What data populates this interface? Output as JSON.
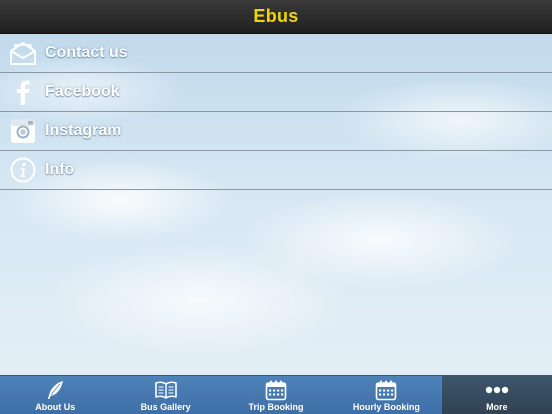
{
  "header": {
    "title": "Ebus"
  },
  "menu": {
    "items": [
      {
        "label": "Contact us",
        "icon": "envelope-icon"
      },
      {
        "label": "Facebook",
        "icon": "facebook-icon"
      },
      {
        "label": "Instagram",
        "icon": "instagram-icon"
      },
      {
        "label": "Info",
        "icon": "info-icon"
      }
    ]
  },
  "tabbar": {
    "tabs": [
      {
        "label": "About Us",
        "icon": "quill-icon",
        "active": false
      },
      {
        "label": "Bus Gallery",
        "icon": "book-icon",
        "active": false
      },
      {
        "label": "Trip Booking",
        "icon": "calendar-icon",
        "active": false
      },
      {
        "label": "Hourly Booking",
        "icon": "calendar-icon",
        "active": false
      },
      {
        "label": "More",
        "icon": "more-dots-icon",
        "active": true
      }
    ]
  },
  "colors": {
    "header_bg": "#2a2a2a",
    "title": "#f2d313",
    "tabbar_bg": "#4577ad",
    "tab_active_bg": "#384b5f"
  }
}
